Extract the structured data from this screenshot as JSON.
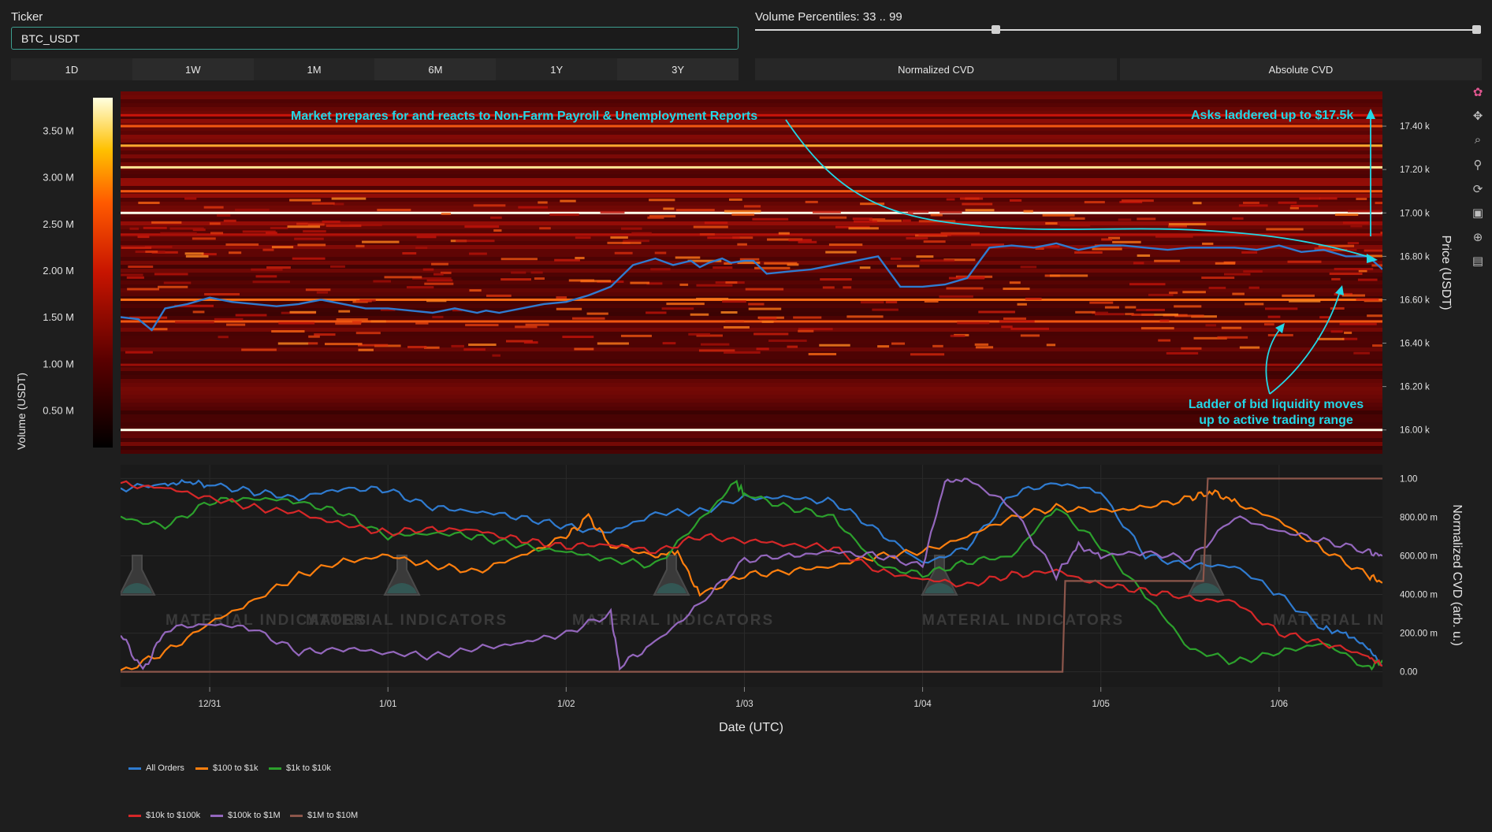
{
  "controls": {
    "ticker_label": "Ticker",
    "ticker_value": "BTC_USDT",
    "volume_percentiles_label": "Volume Percentiles: 33 .. 99",
    "volume_percentiles": [
      33,
      99
    ],
    "timeframes": [
      "1D",
      "1W",
      "1M",
      "6M",
      "1Y",
      "3Y"
    ],
    "cvd_modes": [
      "Normalized CVD",
      "Absolute CVD"
    ]
  },
  "toolbar": {
    "icons": [
      "plotly-logo-icon",
      "pan-icon",
      "zoom-icon",
      "lasso-select-icon",
      "reset-icon",
      "save-icon",
      "crosshair-icon",
      "comment-icon"
    ],
    "glyphs": [
      "✿",
      "✥",
      "⌕",
      "⚲",
      "⟳",
      "▣",
      "⊕",
      "▤"
    ]
  },
  "heatmap": {
    "colorbar_title": "Volume (USDT)",
    "colorbar_ticks": [
      "3.50 M",
      "3.00 M",
      "2.50 M",
      "2.00 M",
      "1.50 M",
      "1.00 M",
      "0.50 M"
    ],
    "colorbar_values": [
      3.5,
      3.0,
      2.5,
      2.0,
      1.5,
      1.0,
      0.5
    ],
    "colorbar_range": [
      0.1,
      3.85
    ],
    "price_axis_title": "Price (USDT)",
    "price_ticks": [
      "17.40 k",
      "17.20 k",
      "17.00 k",
      "16.80 k",
      "16.60 k",
      "16.40 k",
      "16.20 k",
      "16.00 k"
    ],
    "price_values": [
      17400,
      17200,
      17000,
      16800,
      16600,
      16400,
      16200,
      16000
    ],
    "price_range": [
      15890,
      17560
    ],
    "annotations": {
      "nfp": "Market prepares for and reacts to Non-Farm Payroll & Unemployment Reports",
      "asks": "Asks laddered up to $17.5k",
      "bids_line1": "Ladder of bid liquidity moves",
      "bids_line2": "up to active trading range"
    },
    "price_series": {
      "name": "BTC price",
      "x": [
        0.0,
        0.2,
        0.35,
        0.5,
        0.75,
        1.0,
        1.25,
        1.5,
        1.75,
        2.0,
        2.25,
        2.5,
        2.75,
        3.0,
        3.25,
        3.5,
        3.75,
        4.0,
        4.1,
        4.25,
        4.5,
        4.75,
        5.0,
        5.25,
        5.5,
        5.75,
        6.0,
        6.2,
        6.4,
        6.5,
        6.6,
        6.75,
        6.85,
        7.0,
        7.1,
        7.25,
        7.5,
        7.75,
        8.0,
        8.25,
        8.5,
        8.75,
        9.0,
        9.25,
        9.5,
        9.75,
        10.0,
        10.25,
        10.5,
        10.75,
        11.0,
        11.25,
        11.5,
        11.75,
        12.0,
        12.25,
        12.5,
        12.75,
        13.0,
        13.25,
        13.5,
        13.75,
        14.0,
        14.16
      ],
      "values": [
        16520,
        16510,
        16460,
        16560,
        16580,
        16610,
        16590,
        16580,
        16570,
        16580,
        16600,
        16580,
        16560,
        16560,
        16550,
        16540,
        16560,
        16540,
        16550,
        16540,
        16560,
        16580,
        16590,
        16620,
        16660,
        16760,
        16790,
        16760,
        16780,
        16750,
        16770,
        16790,
        16770,
        16780,
        16780,
        16720,
        16730,
        16740,
        16760,
        16780,
        16800,
        16660,
        16660,
        16670,
        16700,
        16840,
        16850,
        16840,
        16860,
        16830,
        16850,
        16850,
        16840,
        16830,
        16840,
        16840,
        16840,
        16830,
        16850,
        16820,
        16830,
        16800,
        16800,
        16740
      ]
    }
  },
  "cvd": {
    "axis_title": "Normalized CVD (arb. u.)",
    "ticks": [
      "1.00",
      "800.00 m",
      "600.00 m",
      "400.00 m",
      "200.00 m",
      "0.00"
    ],
    "tick_values": [
      1.0,
      0.8,
      0.6,
      0.4,
      0.2,
      0.0
    ],
    "y_range": [
      -0.03,
      1.03
    ],
    "watermark": "MATERIAL INDICATORS"
  },
  "x_axis": {
    "title": "Date (UTC)",
    "ticks": [
      "12/31",
      "1/01",
      "1/02",
      "1/03",
      "1/04",
      "1/05",
      "1/06"
    ],
    "tick_values": [
      1,
      3,
      5,
      7,
      9,
      11,
      13
    ],
    "range": [
      0,
      14.16
    ]
  },
  "chart_data": [
    {
      "type": "heatmap",
      "title": "",
      "xlabel": "Date (UTC)",
      "ylabel": "Price (USDT)",
      "x_ticks": [
        "12/31",
        "1/01",
        "1/02",
        "1/03",
        "1/04",
        "1/05",
        "1/06"
      ],
      "y_ticks": [
        "17.40 k",
        "17.20 k",
        "17.00 k",
        "16.80 k",
        "16.60 k",
        "16.40 k",
        "16.20 k",
        "16.00 k"
      ],
      "ylim": [
        15890,
        17560
      ],
      "colorbar": {
        "title": "Volume (USDT)",
        "range": [
          0.1,
          3.85
        ],
        "ticks": [
          "3.50 M",
          "3.00 M",
          "2.50 M",
          "2.00 M",
          "1.50 M",
          "1.00 M",
          "0.50 M"
        ]
      },
      "liquidity_levels": [
        {
          "price": 17450,
          "intensity": 0.55
        },
        {
          "price": 17400,
          "intensity": 0.7
        },
        {
          "price": 17310,
          "intensity": 0.85
        },
        {
          "price": 17210,
          "intensity": 0.95
        },
        {
          "price": 17100,
          "intensity": 0.7
        },
        {
          "price": 17000,
          "intensity": 1.0
        },
        {
          "price": 16900,
          "intensity": 0.5
        },
        {
          "price": 16600,
          "intensity": 0.75
        },
        {
          "price": 16500,
          "intensity": 0.7
        },
        {
          "price": 16300,
          "intensity": 0.45
        },
        {
          "price": 16000,
          "intensity": 1.0
        }
      ],
      "series": [
        {
          "name": "",
          "x": [
            0.0,
            0.5,
            1.0,
            2.0,
            3.0,
            4.0,
            5.0,
            5.75,
            6.0,
            7.0,
            7.25,
            8.0,
            8.5,
            8.75,
            9.0,
            9.5,
            9.75,
            10.5,
            11.0,
            12.0,
            13.0,
            13.5,
            14.0,
            14.16
          ],
          "values": [
            16520,
            16560,
            16610,
            16580,
            16560,
            16540,
            16590,
            16760,
            16790,
            16780,
            16720,
            16760,
            16800,
            16660,
            16660,
            16700,
            16840,
            16860,
            16850,
            16840,
            16850,
            16830,
            16800,
            16740
          ]
        }
      ],
      "annotations": [
        "Market prepares for and reacts to Non-Farm Payroll & Unemployment Reports",
        "Asks laddered up to $17.5k",
        "Ladder of bid liquidity moves",
        "up to active trading range"
      ]
    },
    {
      "type": "line",
      "title": "",
      "xlabel": "Date (UTC)",
      "ylabel": "Normalized CVD (arb. u.)",
      "x_ticks": [
        "12/31",
        "1/01",
        "1/02",
        "1/03",
        "1/04",
        "1/05",
        "1/06"
      ],
      "ylim": [
        0,
        1
      ],
      "y_ticks": [
        "1.00",
        "800.00 m",
        "600.00 m",
        "400.00 m",
        "200.00 m",
        "0.00"
      ],
      "legend": "bottom-left",
      "series": [
        {
          "name": "All Orders",
          "color": "#2f7bd0",
          "x": [
            0.0,
            0.5,
            0.75,
            1.0,
            1.5,
            2.0,
            2.5,
            3.0,
            3.5,
            4.0,
            4.5,
            5.0,
            5.5,
            6.0,
            6.5,
            7.0,
            7.5,
            8.0,
            8.5,
            9.0,
            9.5,
            10.0,
            10.5,
            11.0,
            11.5,
            12.0,
            12.5,
            13.0,
            13.5,
            13.75,
            14.0,
            14.16
          ],
          "values": [
            0.95,
            0.97,
            0.98,
            0.97,
            0.93,
            0.9,
            0.95,
            0.94,
            0.85,
            0.83,
            0.8,
            0.75,
            0.72,
            0.82,
            0.83,
            0.9,
            0.9,
            0.88,
            0.73,
            0.56,
            0.64,
            0.92,
            0.98,
            0.93,
            0.6,
            0.55,
            0.55,
            0.4,
            0.22,
            0.2,
            0.12,
            0.03
          ]
        },
        {
          "name": "$100 to $1k",
          "color": "#ff7f0e",
          "x": [
            0.0,
            0.5,
            1.0,
            1.5,
            2.0,
            2.5,
            3.0,
            3.5,
            4.0,
            4.5,
            5.0,
            5.25,
            5.5,
            6.0,
            6.25,
            6.5,
            7.0,
            7.5,
            8.0,
            8.5,
            9.0,
            9.5,
            10.0,
            10.5,
            11.0,
            11.5,
            12.0,
            12.25,
            12.5,
            13.0,
            13.5,
            14.0,
            14.16
          ],
          "values": [
            0.0,
            0.1,
            0.25,
            0.37,
            0.5,
            0.57,
            0.6,
            0.55,
            0.52,
            0.6,
            0.7,
            0.8,
            0.66,
            0.6,
            0.62,
            0.4,
            0.5,
            0.52,
            0.55,
            0.6,
            0.62,
            0.7,
            0.8,
            0.85,
            0.83,
            0.85,
            0.9,
            0.93,
            0.88,
            0.78,
            0.63,
            0.5,
            0.46
          ]
        },
        {
          "name": "$1k to $10k",
          "color": "#2ca02c",
          "x": [
            0.0,
            0.5,
            1.0,
            1.5,
            2.0,
            2.5,
            3.0,
            3.5,
            4.0,
            4.5,
            5.0,
            5.5,
            6.0,
            6.5,
            6.9,
            7.0,
            7.5,
            8.0,
            8.5,
            9.0,
            9.5,
            10.0,
            10.5,
            11.0,
            11.5,
            12.0,
            12.5,
            13.0,
            13.5,
            14.0,
            14.16
          ],
          "values": [
            0.8,
            0.75,
            0.88,
            0.9,
            0.88,
            0.82,
            0.7,
            0.72,
            0.7,
            0.65,
            0.62,
            0.58,
            0.55,
            0.78,
            0.98,
            0.92,
            0.85,
            0.8,
            0.55,
            0.5,
            0.57,
            0.6,
            0.85,
            0.65,
            0.4,
            0.12,
            0.05,
            0.1,
            0.15,
            0.02,
            0.06
          ]
        },
        {
          "name": "$10k to $100k",
          "color": "#d62728",
          "x": [
            0.0,
            0.5,
            1.0,
            1.5,
            2.0,
            2.5,
            3.0,
            3.5,
            4.0,
            4.5,
            5.0,
            5.5,
            6.0,
            6.5,
            7.0,
            7.5,
            8.0,
            8.5,
            9.0,
            9.5,
            10.0,
            10.5,
            11.0,
            11.5,
            12.0,
            12.5,
            13.0,
            13.5,
            14.0,
            14.16
          ],
          "values": [
            0.97,
            0.95,
            0.9,
            0.85,
            0.82,
            0.76,
            0.72,
            0.74,
            0.73,
            0.68,
            0.65,
            0.66,
            0.62,
            0.7,
            0.68,
            0.66,
            0.64,
            0.52,
            0.48,
            0.45,
            0.5,
            0.52,
            0.45,
            0.42,
            0.38,
            0.36,
            0.2,
            0.15,
            0.08,
            0.03
          ]
        },
        {
          "name": "$100k to $1M",
          "color": "#9467bd",
          "x": [
            0.0,
            0.25,
            0.5,
            1.0,
            1.5,
            2.0,
            2.5,
            3.0,
            3.5,
            4.0,
            4.5,
            5.0,
            5.5,
            5.6,
            6.0,
            6.5,
            7.0,
            7.5,
            8.0,
            8.5,
            9.0,
            9.25,
            9.5,
            10.0,
            10.5,
            10.75,
            11.0,
            11.5,
            12.0,
            12.5,
            13.0,
            13.5,
            14.0,
            14.16
          ],
          "values": [
            0.2,
            0.0,
            0.22,
            0.25,
            0.22,
            0.1,
            0.12,
            0.1,
            0.08,
            0.12,
            0.15,
            0.2,
            0.3,
            0.03,
            0.15,
            0.35,
            0.58,
            0.6,
            0.62,
            0.6,
            0.55,
            0.98,
            1.0,
            0.85,
            0.5,
            0.65,
            0.6,
            0.62,
            0.58,
            0.8,
            0.73,
            0.68,
            0.62,
            0.6
          ]
        },
        {
          "name": "$1M to $10M",
          "color": "#8c564b",
          "x": [
            0.0,
            10.57,
            10.6,
            12.15,
            12.2,
            14.16
          ],
          "values": [
            0.0,
            0.0,
            0.47,
            0.47,
            1.0,
            1.0
          ]
        }
      ]
    }
  ]
}
